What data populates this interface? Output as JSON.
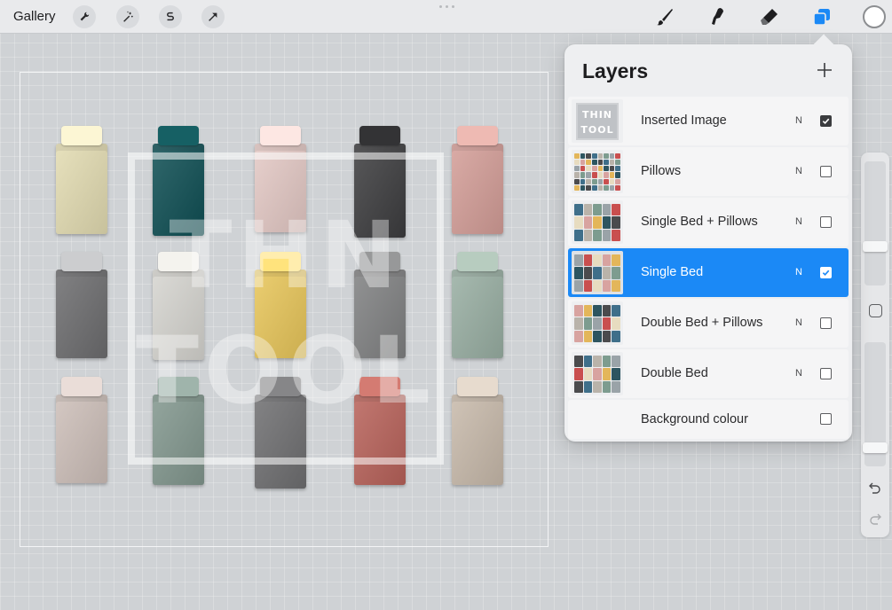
{
  "topbar": {
    "gallery_label": "Gallery",
    "left_tools": [
      "wrench-icon",
      "magic-wand-icon",
      "selection-icon",
      "transform-arrow-icon"
    ],
    "right_tools": [
      "brush-icon",
      "smudge-icon",
      "eraser-icon",
      "layers-icon"
    ],
    "active_tool_color": "#1b89f6",
    "current_color": "#ffffff"
  },
  "canvas": {
    "watermark_line1": "THN",
    "watermark_line2": "TOOL",
    "beds": [
      {
        "color": "#e3dcb2",
        "pillow": "#e9e4c4"
      },
      {
        "color": "#0f4f54",
        "pillow": "#14595d"
      },
      {
        "color": "#e4c9c5",
        "pillow": "#ead6d2"
      },
      {
        "color": "#3d3d3f",
        "pillow": "#2f2f31"
      },
      {
        "color": "#d49e98",
        "pillow": "#dcaca6"
      },
      {
        "color": "#6d6d6f",
        "pillow": "#bdbec0"
      },
      {
        "color": "#d6d5d0",
        "pillow": "#e2e1dc"
      },
      {
        "color": "#e8c65a",
        "pillow": "#eed273"
      },
      {
        "color": "#808182",
        "pillow": "#8c8d8e"
      },
      {
        "color": "#99afa3",
        "pillow": "#a9bdb1"
      },
      {
        "color": "#cdbfb9",
        "pillow": "#d9cdc8"
      },
      {
        "color": "#82978e",
        "pillow": "#93a79e"
      },
      {
        "color": "#6f6f71",
        "pillow": "#7c7c7e"
      },
      {
        "color": "#b8625a",
        "pillow": "#c4726a"
      },
      {
        "color": "#c8baab",
        "pillow": "#d6cbbf"
      }
    ]
  },
  "layers_panel": {
    "title": "Layers",
    "add_icon": "plus-icon",
    "layers": [
      {
        "name": "Inserted Image",
        "blend": "N",
        "visible": true,
        "selected": false,
        "thumb": "watermark"
      },
      {
        "name": "Pillows",
        "blend": "N",
        "visible": false,
        "selected": false,
        "thumb": "pillows"
      },
      {
        "name": "Single Bed + Pillows",
        "blend": "N",
        "visible": false,
        "selected": false,
        "thumb": "single-pillows"
      },
      {
        "name": "Single Bed",
        "blend": "N",
        "visible": true,
        "selected": true,
        "thumb": "single"
      },
      {
        "name": "Double Bed + Pillows",
        "blend": "N",
        "visible": false,
        "selected": false,
        "thumb": "double-pillows"
      },
      {
        "name": "Double Bed",
        "blend": "N",
        "visible": false,
        "selected": false,
        "thumb": "double"
      },
      {
        "name": "Background colour",
        "blend": "",
        "visible": false,
        "selected": false,
        "thumb": "none"
      }
    ],
    "thumb_watermark_line1": "THIN",
    "thumb_watermark_line2": "TOOL"
  },
  "sidebar": {
    "undo_icon": "undo-icon",
    "redo_icon": "redo-icon",
    "modify_icon": "square-modify-icon"
  }
}
